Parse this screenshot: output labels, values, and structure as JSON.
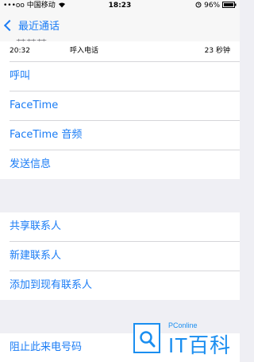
{
  "status_bar": {
    "carrier": "•••oo 中国移动",
    "wifi_icon": "wifi-icon",
    "time": "18:23",
    "alarm_icon": "alarm-icon",
    "battery": "96%",
    "battery_icon": "battery-icon"
  },
  "nav": {
    "back_label": "最近通话",
    "back_icon": "chevron-left-icon",
    "partial_title": "某某某"
  },
  "call_log": {
    "time": "20:32",
    "type": "呼入电话",
    "duration": "23 秒钟"
  },
  "actions_group1": [
    {
      "label": "呼叫"
    },
    {
      "label": "FaceTime"
    },
    {
      "label": "FaceTime 音频"
    },
    {
      "label": "发送信息"
    }
  ],
  "actions_group2": [
    {
      "label": "共享联系人"
    },
    {
      "label": "新建联系人"
    },
    {
      "label": "添加到现有联系人"
    }
  ],
  "actions_group3": [
    {
      "label": "阻止此来电号码"
    }
  ],
  "watermark": {
    "small": "PConline",
    "big": "IT百科"
  },
  "colors": {
    "accent": "#1a7cf5",
    "background": "#efeff4",
    "watermark": "#1a8ef0"
  }
}
